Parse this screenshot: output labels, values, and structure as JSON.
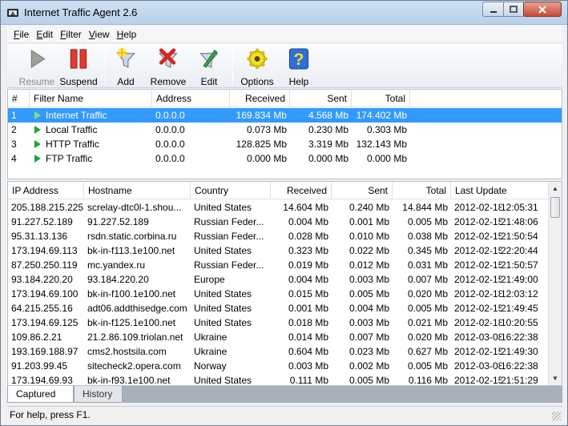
{
  "window": {
    "title": "Internet Traffic Agent 2.6"
  },
  "menu": [
    {
      "label": "File",
      "ul": "F",
      "rest": "ile"
    },
    {
      "label": "Edit",
      "ul": "E",
      "rest": "dit"
    },
    {
      "label": "Filter",
      "ul": "F",
      "rest": "ilter"
    },
    {
      "label": "View",
      "ul": "V",
      "rest": "iew"
    },
    {
      "label": "Help",
      "ul": "H",
      "rest": "elp"
    }
  ],
  "toolbar": {
    "resume": "Resume",
    "suspend": "Suspend",
    "add": "Add",
    "remove": "Remove",
    "edit": "Edit",
    "options": "Options",
    "help": "Help"
  },
  "filters": {
    "headers": [
      "#",
      "Filter Name",
      "Address",
      "Received",
      "Sent",
      "Total"
    ],
    "rows": [
      [
        "1",
        "Internet Traffic",
        "0.0.0.0",
        "169.834 Mb",
        "4.568 Mb",
        "174.402 Mb"
      ],
      [
        "2",
        "Local Traffic",
        "0.0.0.0",
        "0.073 Mb",
        "0.230 Mb",
        "0.303 Mb"
      ],
      [
        "3",
        "HTTP Traffic",
        "0.0.0.0",
        "128.825 Mb",
        "3.319 Mb",
        "132.143 Mb"
      ],
      [
        "4",
        "FTP Traffic",
        "0.0.0.0",
        "0.000 Mb",
        "0.000 Mb",
        "0.000 Mb"
      ]
    ],
    "selected_row": 0
  },
  "captured": {
    "headers": [
      "IP Address",
      "Hostname",
      "Country",
      "Received",
      "Sent",
      "Total",
      "Last Update"
    ],
    "rows": [
      [
        "205.188.215.225",
        "screlay-dtc0l-1.shou...",
        "United States",
        "14.604 Mb",
        "0.240 Mb",
        "14.844 Mb",
        "2012-02-18",
        "12:05:31"
      ],
      [
        "91.227.52.189",
        "91.227.52.189",
        "Russian Feder...",
        "0.004 Mb",
        "0.001 Mb",
        "0.005 Mb",
        "2012-02-15",
        "21:48:06"
      ],
      [
        "95.31.13.136",
        "rsdn.static.corbina.ru",
        "Russian Feder...",
        "0.028 Mb",
        "0.010 Mb",
        "0.038 Mb",
        "2012-02-15",
        "21:50:54"
      ],
      [
        "173.194.69.113",
        "bk-in-f113.1e100.net",
        "United States",
        "0.323 Mb",
        "0.022 Mb",
        "0.345 Mb",
        "2012-02-15",
        "22:20:44"
      ],
      [
        "87.250.250.119",
        "mc.yandex.ru",
        "Russian Feder...",
        "0.019 Mb",
        "0.012 Mb",
        "0.031 Mb",
        "2012-02-15",
        "21:50:57"
      ],
      [
        "93.184.220.20",
        "93.184.220.20",
        "Europe",
        "0.004 Mb",
        "0.003 Mb",
        "0.007 Mb",
        "2012-02-15",
        "21:49:00"
      ],
      [
        "173.194.69.100",
        "bk-in-f100.1e100.net",
        "United States",
        "0.015 Mb",
        "0.005 Mb",
        "0.020 Mb",
        "2012-02-18",
        "12:03:12"
      ],
      [
        "64.215.255.16",
        "adt06.addthisedge.com",
        "United States",
        "0.001 Mb",
        "0.004 Mb",
        "0.005 Mb",
        "2012-02-15",
        "21:49:45"
      ],
      [
        "173.194.69.125",
        "bk-in-f125.1e100.net",
        "United States",
        "0.018 Mb",
        "0.003 Mb",
        "0.021 Mb",
        "2012-02-18",
        "10:20:55"
      ],
      [
        "109.86.2.21",
        "21.2.86.109.triolan.net",
        "Ukraine",
        "0.014 Mb",
        "0.007 Mb",
        "0.020 Mb",
        "2012-03-08",
        "16:22:38"
      ],
      [
        "193.169.188.97",
        "cms2.hostsila.com",
        "Ukraine",
        "0.604 Mb",
        "0.023 Mb",
        "0.627 Mb",
        "2012-02-15",
        "21:49:30"
      ],
      [
        "91.203.99.45",
        "sitecheck2.opera.com",
        "Norway",
        "0.003 Mb",
        "0.002 Mb",
        "0.005 Mb",
        "2012-03-08",
        "16:22:38"
      ],
      [
        "173.194.69.93",
        "bk-in-f93.1e100.net",
        "United States",
        "0.111 Mb",
        "0.005 Mb",
        "0.116 Mb",
        "2012-02-15",
        "21:51:29"
      ]
    ]
  },
  "tabs": [
    "Captured IP",
    "History"
  ],
  "status": {
    "text": "For help, press F1."
  },
  "colors": {
    "selection": "#3399ff",
    "play_green": "#22a33a"
  }
}
